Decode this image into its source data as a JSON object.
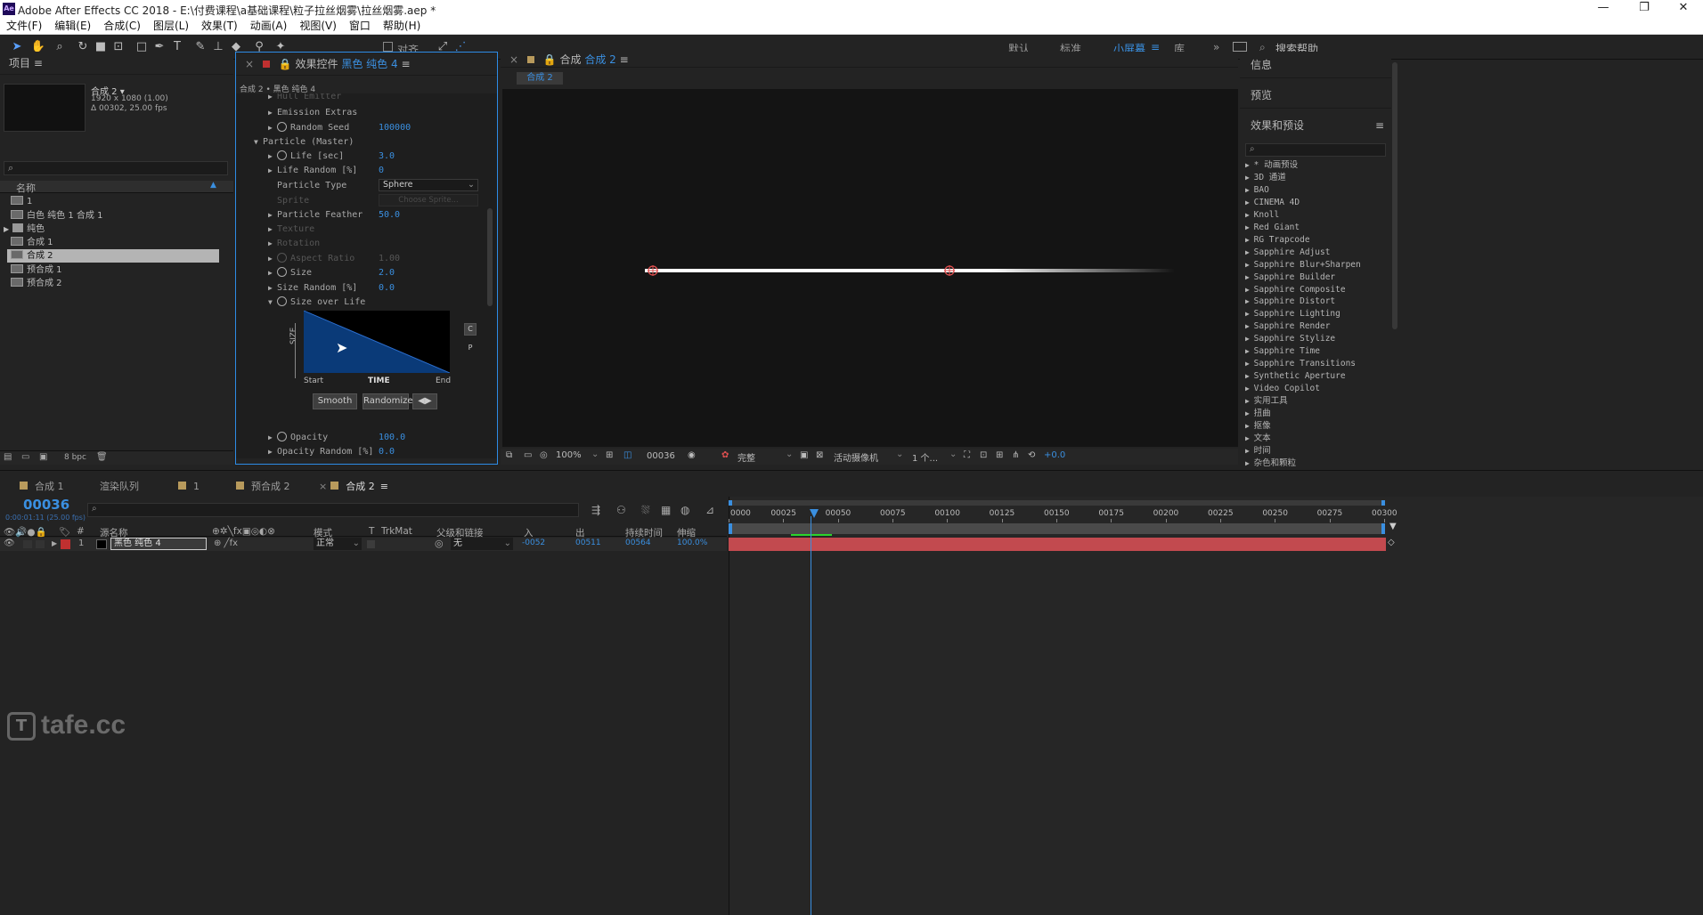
{
  "window": {
    "app_logo": "Ae",
    "title": "Adobe After Effects CC 2018 - E:\\付费课程\\a基础课程\\粒子拉丝烟雾\\拉丝烟雾.aep *",
    "min": "—",
    "max": "❐",
    "close": "✕"
  },
  "menu": [
    "文件(F)",
    "编辑(E)",
    "合成(C)",
    "图层(L)",
    "效果(T)",
    "动画(A)",
    "视图(V)",
    "窗口",
    "帮助(H)"
  ],
  "toolbar": {
    "snap_label": "对齐",
    "workspaces": [
      "默认",
      "标准",
      "小屏幕",
      "库"
    ],
    "active_workspace": "小屏幕",
    "search_placeholder": "搜索帮助",
    "more": "»"
  },
  "project": {
    "title": "项目",
    "comp_name": "合成 2 ▾",
    "comp_res": "1920 x 1080 (1.00)",
    "comp_dur": "Δ 00302, 25.00 fps",
    "col_name": "名称",
    "items": [
      {
        "label": "1",
        "type": "comp"
      },
      {
        "label": "白色 纯色 1 合成 1",
        "type": "comp"
      },
      {
        "label": "纯色",
        "type": "folder"
      },
      {
        "label": "合成 1",
        "type": "comp"
      },
      {
        "label": "合成 2",
        "type": "comp",
        "selected": true
      },
      {
        "label": "预合成 1",
        "type": "comp"
      },
      {
        "label": "预合成 2",
        "type": "comp"
      }
    ],
    "bpc": "8 bpc"
  },
  "effects_panel": {
    "title_prefix": "效果控件",
    "title_layer": "黑色 纯色 4",
    "breadcrumb": "合成 2 • 黑色 纯色 4",
    "rows": [
      {
        "label": "Emission Extras",
        "value": "",
        "indent": 1
      },
      {
        "label": "Random Seed",
        "value": "100000",
        "indent": 1,
        "clock": true
      },
      {
        "label": "Particle (Master)",
        "value": "",
        "indent": 0,
        "open": true
      },
      {
        "label": "Life [sec]",
        "value": "3.0",
        "indent": 1,
        "clock": true
      },
      {
        "label": "Life Random [%]",
        "value": "0",
        "indent": 1
      },
      {
        "label": "Particle Type",
        "value": "Sphere",
        "indent": 1,
        "select": true
      },
      {
        "label": "Sprite",
        "value": "Choose Sprite...",
        "indent": 1,
        "dim": true
      },
      {
        "label": "Particle Feather",
        "value": "50.0",
        "indent": 1
      },
      {
        "label": "Texture",
        "value": "",
        "indent": 1,
        "dim": true
      },
      {
        "label": "Rotation",
        "value": "",
        "indent": 1,
        "dim": true
      },
      {
        "label": "Aspect Ratio",
        "value": "1.00",
        "indent": 1,
        "dim": true,
        "clock": true
      },
      {
        "label": "Size",
        "value": "2.0",
        "indent": 1,
        "clock": true
      },
      {
        "label": "Size Random [%]",
        "value": "0.0",
        "indent": 1
      },
      {
        "label": "Size over Life",
        "value": "",
        "indent": 1,
        "clock": true,
        "open": true
      }
    ],
    "graph": {
      "ylabel": "SIZE",
      "xlabel": "TIME",
      "start": "Start",
      "end": "End",
      "btn_smooth": "Smooth",
      "btn_randomize": "Randomize",
      "btn_arrows": "◀▶",
      "side_c": "C",
      "side_p": "P"
    },
    "rows2": [
      {
        "label": "Opacity",
        "value": "100.0",
        "clock": true
      },
      {
        "label": "Opacity Random [%]",
        "value": "0.0"
      }
    ]
  },
  "composition": {
    "title_prefix": "合成",
    "title_name": "合成 2",
    "tab": "合成 2",
    "footer": {
      "zoom": "100%",
      "time": "00036",
      "quality": "完整",
      "camera": "活动摄像机",
      "views": "1 个...",
      "exposure": "+0.0"
    }
  },
  "right_panel": {
    "info": "信息",
    "preview": "预览",
    "effects_title": "效果和预设",
    "items": [
      "* 动画预设",
      "3D 通道",
      "BAO",
      "CINEMA 4D",
      "Knoll",
      "Red Giant",
      "RG Trapcode",
      "Sapphire Adjust",
      "Sapphire Blur+Sharpen",
      "Sapphire Builder",
      "Sapphire Composite",
      "Sapphire Distort",
      "Sapphire Lighting",
      "Sapphire Render",
      "Sapphire Stylize",
      "Sapphire Time",
      "Sapphire Transitions",
      "Synthetic Aperture",
      "Video Copilot",
      "实用工具",
      "扭曲",
      "抠像",
      "文本",
      "时间",
      "杂色和颗粒"
    ]
  },
  "timeline": {
    "tabs": [
      {
        "label": "合成 1",
        "color": "#b89a5c"
      },
      {
        "label": "渲染队列",
        "color": ""
      },
      {
        "label": "1",
        "color": "#b89a5c"
      },
      {
        "label": "预合成 2",
        "color": "#b89a5c"
      },
      {
        "label": "合成 2",
        "color": "#b89a5c",
        "active": true
      }
    ],
    "timecode": "00036",
    "timecode_sub": "0:00:01:11 (25.00 fps)",
    "cols": {
      "num": "#",
      "source": "源名称",
      "mode": "模式",
      "t": "T",
      "trkmat": "TrkMat",
      "parent": "父级和链接",
      "in": "入",
      "out": "出",
      "duration": "持续时间",
      "stretch": "伸缩"
    },
    "layer": {
      "index": "1",
      "name": "黑色 纯色 4",
      "mode": "正常",
      "parent": "无",
      "in": "-0052",
      "out": "00511",
      "duration": "00564",
      "stretch": "100.0%"
    },
    "ruler": [
      "0000",
      "00025",
      "00050",
      "00075",
      "00100",
      "00125",
      "00150",
      "00175",
      "00200",
      "00225",
      "00250",
      "00275",
      "00300"
    ]
  },
  "watermark": "tafe.cc"
}
